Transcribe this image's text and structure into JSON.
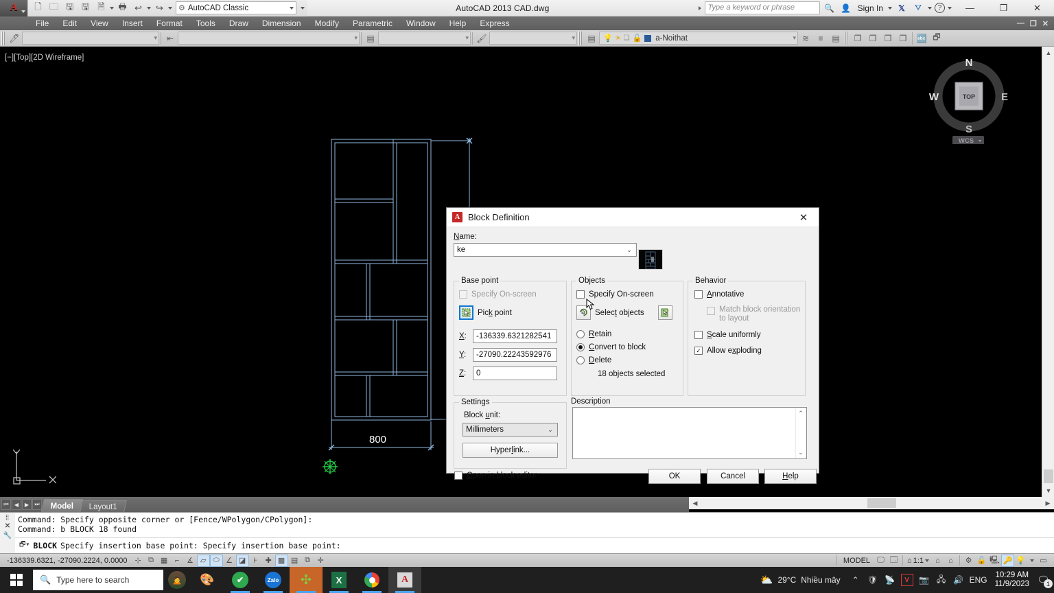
{
  "titlebar": {
    "app_logo": "autocad-logo",
    "quick_access": [
      {
        "name": "new-icon",
        "glyph": "🗋"
      },
      {
        "name": "open-icon",
        "glyph": "🗁"
      },
      {
        "name": "save-icon",
        "glyph": "🖫"
      },
      {
        "name": "saveas-icon",
        "glyph": "🖫"
      },
      {
        "name": "plot-preview-icon",
        "glyph": "🗎"
      },
      {
        "name": "plot-icon",
        "glyph": "🖶"
      },
      {
        "name": "undo-icon",
        "glyph": "↩"
      },
      {
        "name": "redo-icon",
        "glyph": "↪"
      }
    ],
    "workspace": "AutoCAD Classic",
    "window_title": "AutoCAD 2013    CAD.dwg",
    "search_placeholder": "Type a keyword or phrase",
    "sign_in": "Sign In",
    "minimize": "—",
    "maximize": "❐",
    "close": "✕",
    "doc_minimize": "—",
    "doc_restore": "❐",
    "doc_close": "✕"
  },
  "menubar": {
    "items": [
      "File",
      "Edit",
      "View",
      "Insert",
      "Format",
      "Tools",
      "Draw",
      "Dimension",
      "Modify",
      "Parametric",
      "Window",
      "Help",
      "Express"
    ]
  },
  "toolbar": {
    "text_style_value": "",
    "dim_style_value": "",
    "table_style_value": "",
    "mleader_style_value": "",
    "layer_value": "a-Noithat"
  },
  "canvas": {
    "viewport_label": "[−][Top][2D Wireframe]",
    "dimension_text": "800",
    "navcube": {
      "north": "N",
      "south": "S",
      "east": "E",
      "west": "W",
      "top": "TOP",
      "wcs": "WCS"
    },
    "ucs_x": "X",
    "ucs_y": "Y"
  },
  "model_tabs": {
    "nav": [
      "⏮",
      "◀",
      "▶",
      "⏭"
    ],
    "tabs": [
      {
        "label": "Model",
        "active": true
      },
      {
        "label": "Layout1",
        "active": false
      }
    ]
  },
  "command_line": {
    "history": [
      "Command: Specify opposite corner or [Fence/WPolygon/CPolygon]:",
      "Command: b BLOCK 18 found"
    ],
    "prompt_command": "BLOCK",
    "prompt_text": "Specify insertion base point: Specify insertion base point:"
  },
  "status_bar": {
    "coordinates": "-136339.6321, -27090.2224, 0.0000",
    "model_label": "MODEL",
    "annotation_scale": "1:1",
    "toggles": [
      {
        "name": "infer-constraints-icon",
        "glyph": "⊹",
        "on": false
      },
      {
        "name": "snap-mode-icon",
        "glyph": "▦",
        "on": false
      },
      {
        "name": "grid-display-icon",
        "glyph": "▦",
        "on": false
      },
      {
        "name": "ortho-mode-icon",
        "glyph": "⌐",
        "on": false
      },
      {
        "name": "polar-tracking-icon",
        "glyph": "∡",
        "on": false
      },
      {
        "name": "object-snap-icon",
        "glyph": "▱",
        "on": true
      },
      {
        "name": "3d-object-snap-icon",
        "glyph": "⬭",
        "on": true
      },
      {
        "name": "object-snap-tracking-icon",
        "glyph": "∠",
        "on": false
      },
      {
        "name": "dynamic-ucs-icon",
        "glyph": "◲",
        "on": true
      },
      {
        "name": "dynamic-input-icon",
        "glyph": "⊦",
        "on": false
      },
      {
        "name": "lineweight-icon",
        "glyph": "✚",
        "on": false
      },
      {
        "name": "transparency-icon",
        "glyph": "▩",
        "on": true
      },
      {
        "name": "quick-properties-icon",
        "glyph": "▤",
        "on": false
      },
      {
        "name": "selection-cycling-icon",
        "glyph": "⧉",
        "on": false
      },
      {
        "name": "annotation-monitor-icon",
        "glyph": "✛",
        "on": false
      }
    ]
  },
  "taskbar": {
    "search_placeholder": "Type here to search",
    "apps": [
      {
        "name": "taskbar-app-cortana",
        "glyph": "🙋"
      },
      {
        "name": "taskbar-app-paint",
        "glyph": "🎨"
      },
      {
        "name": "taskbar-app-unikey",
        "glyph": "✔"
      },
      {
        "name": "taskbar-app-zalo",
        "glyph": "Zalo"
      },
      {
        "name": "taskbar-app-sketchup",
        "glyph": "✣"
      },
      {
        "name": "taskbar-app-excel",
        "glyph": "X"
      },
      {
        "name": "taskbar-app-chrome",
        "glyph": "◉"
      },
      {
        "name": "taskbar-app-autocad",
        "glyph": "A"
      }
    ],
    "weather_temp": "29°C",
    "weather_text": "Nhiều mây",
    "language": "ENG",
    "time": "10:29 AM",
    "date": "11/9/2023",
    "notification_count": "1"
  },
  "dialog": {
    "title": "Block Definition",
    "close_label": "✕",
    "name_label": "Name:",
    "name_value": "ke",
    "preview_name": "block-preview-thumbnail",
    "base_point": {
      "group_label": "Base point",
      "specify_onscreen": "Specify On-screen",
      "specify_onscreen_checked": false,
      "specify_onscreen_disabled": true,
      "pick_point_label": "Pick point",
      "x_label": "X:",
      "x_value": "-136339.6321282541",
      "y_label": "Y:",
      "y_value": "-27090.22243592976",
      "z_label": "Z:",
      "z_value": "0"
    },
    "objects": {
      "group_label": "Objects",
      "specify_onscreen": "Specify On-screen",
      "specify_onscreen_checked": false,
      "select_objects_label": "Select objects",
      "quick_select_name": "quick-select-icon",
      "retain": "Retain",
      "convert_to_block": "Convert to block",
      "delete": "Delete",
      "selected_option": "convert_to_block",
      "objects_selected": "18 objects selected"
    },
    "behavior": {
      "group_label": "Behavior",
      "annotative": "Annotative",
      "annotative_checked": false,
      "match_orientation_line1": "Match block orientation",
      "match_orientation_line2": "to layout",
      "match_orientation_checked": false,
      "match_orientation_disabled": true,
      "scale_uniformly": "Scale uniformly",
      "scale_uniformly_checked": false,
      "allow_exploding": "Allow exploding",
      "allow_exploding_checked": true
    },
    "settings": {
      "group_label": "Settings",
      "block_unit_label": "Block unit:",
      "block_unit_value": "Millimeters",
      "hyperlink_button": "Hyperlink..."
    },
    "description": {
      "group_label": "Description",
      "value": ""
    },
    "open_in_block_editor": "Open in block editor",
    "open_in_block_editor_checked": false,
    "ok": "OK",
    "cancel": "Cancel",
    "help": "Help"
  },
  "colors": {
    "canvas_bg": "#000000",
    "cad_line": "#8fb8e0",
    "dim_line": "#8fb8e0",
    "grip_green": "#22cc44",
    "accent_blue": "#1177cc",
    "dialog_bg": "#f0f0f0",
    "taskbar_bg": "#1f1f1f"
  }
}
